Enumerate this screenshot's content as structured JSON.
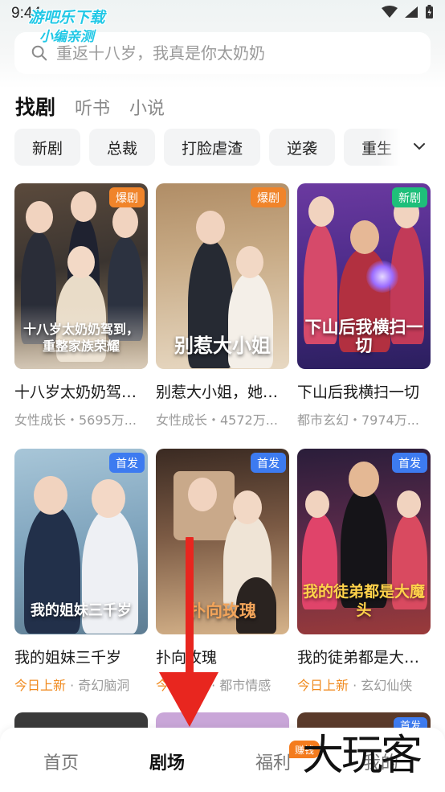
{
  "status_bar": {
    "time": "9:44"
  },
  "watermark": {
    "line1": "游吧乐下载",
    "line2": "小编亲测"
  },
  "search": {
    "placeholder": "重返十八岁，我真是你太奶奶"
  },
  "main_tabs": [
    {
      "label": "找剧",
      "active": true
    },
    {
      "label": "听书",
      "active": false
    },
    {
      "label": "小说",
      "active": false
    }
  ],
  "categories": [
    "新剧",
    "总裁",
    "打脸虐渣",
    "逆袭",
    "重生"
  ],
  "cards": [
    {
      "title": "十八岁太奶奶驾到，重整家族荣耀",
      "genre": "女性成长",
      "plays": "5695万",
      "meta": "女性成长・5695万...",
      "badge": "爆剧",
      "badge_color": "#f0842a",
      "cover_text": "十八岁太奶奶驾到，重整家族荣耀"
    },
    {
      "title": "别惹大小姐，她是京都亲爸是女儿奴",
      "genre": "女性成长",
      "plays": "4572万",
      "meta": "女性成长・4572万...",
      "badge": "爆剧",
      "badge_color": "#f0842a",
      "cover_text": "别惹大小姐"
    },
    {
      "title": "下山后我横扫一切",
      "genre": "都市玄幻",
      "plays": "7974万",
      "meta": "都市玄幻・7974万...",
      "badge": "新剧",
      "badge_color": "#1fbf7a",
      "cover_text": "下山后我横扫一切"
    },
    {
      "title": "我的姐妹三千岁",
      "highlight": "今日上新",
      "meta": "奇幻脑洞",
      "badge": "首发",
      "badge_color": "#3d7bf0",
      "cover_text": "我的姐妹三千岁"
    },
    {
      "title": "扑向玫瑰",
      "highlight": "今日上新",
      "meta": "都市情感",
      "badge": "首发",
      "badge_color": "#3d7bf0",
      "cover_text": "扑向玫瑰"
    },
    {
      "title": "我的徒弟都是大魔头",
      "highlight": "今日上新",
      "meta": "玄幻仙侠",
      "badge": "首发",
      "badge_color": "#3d7bf0",
      "cover_text": "我的徒弟都是大魔头"
    }
  ],
  "peek_badge": "首发",
  "bottom_nav": [
    {
      "label": "首页",
      "active": false
    },
    {
      "label": "剧场",
      "active": true
    },
    {
      "label": "福利",
      "active": false,
      "badge": "赚钱"
    },
    {
      "label": "我的",
      "active": false
    }
  ],
  "brand_watermark": "大玩客",
  "colors": {
    "accent_orange": "#f08a1e",
    "badge_blue": "#3d7bf0",
    "badge_green": "#1fbf7a",
    "arrow_red": "#e8261f"
  }
}
